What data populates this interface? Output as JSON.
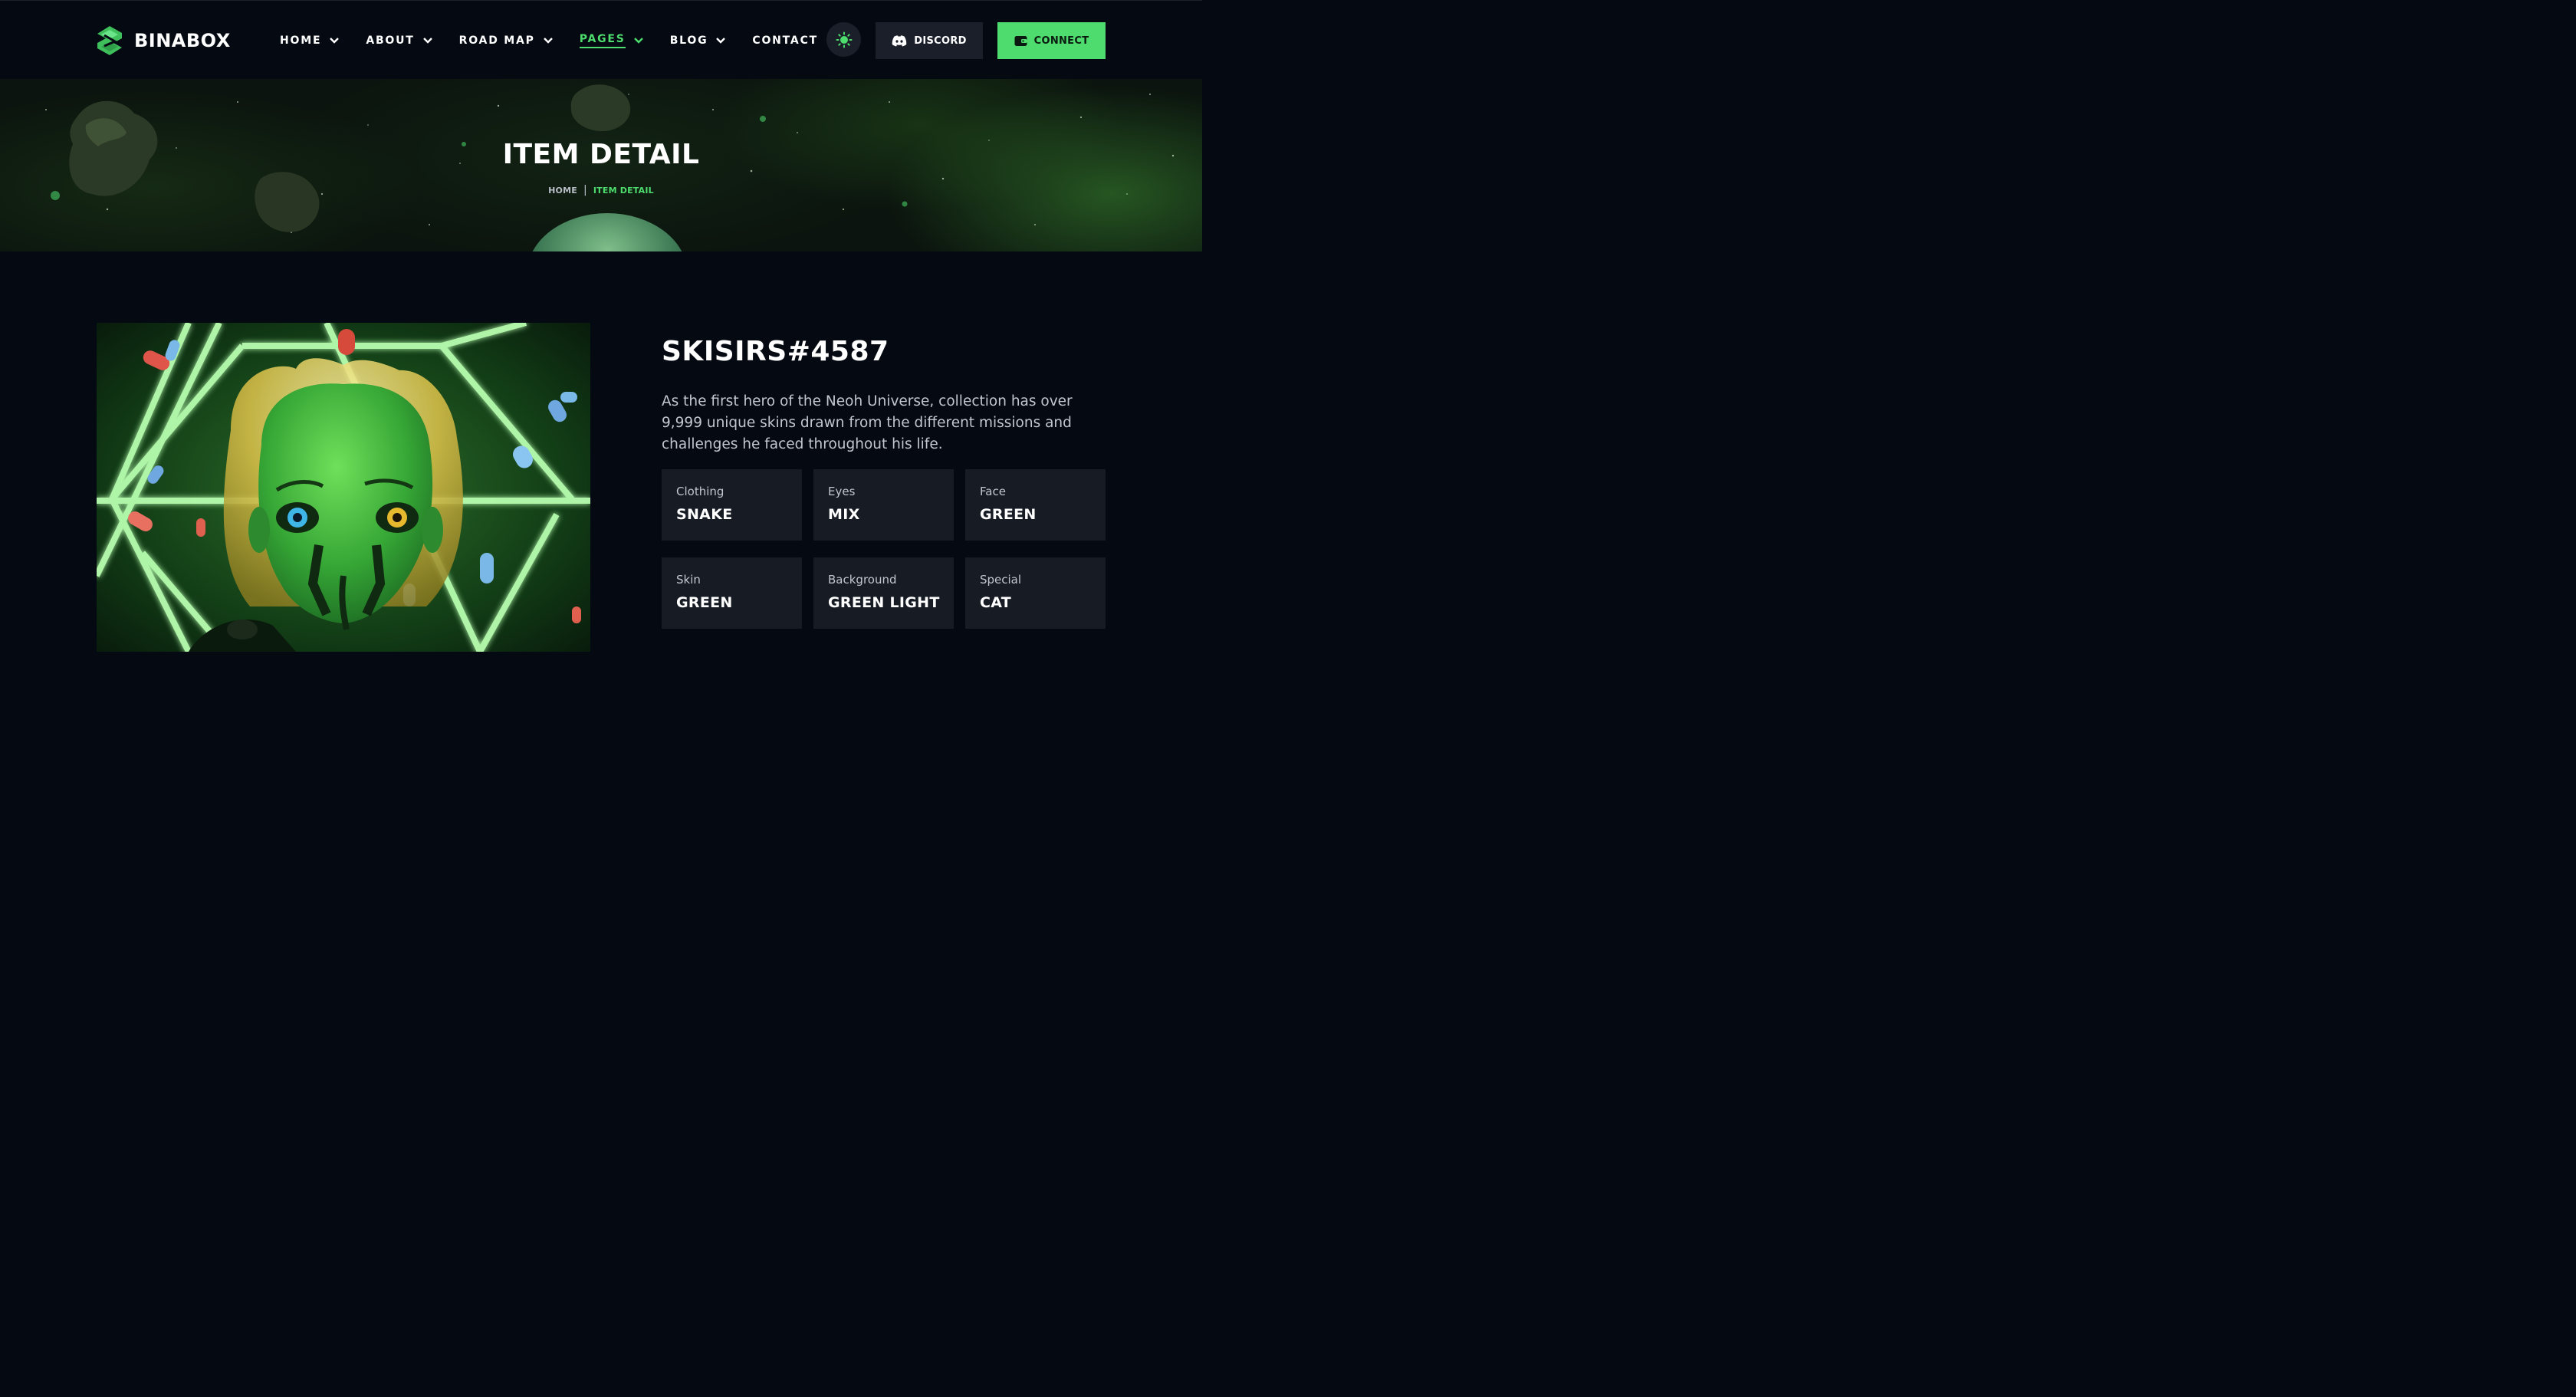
{
  "brand": {
    "name": "BINABOX",
    "accent": "#4ddc6d",
    "background": "#050a12"
  },
  "nav": [
    {
      "label": "HOME",
      "has_dropdown": true,
      "active": false
    },
    {
      "label": "ABOUT",
      "has_dropdown": true,
      "active": false
    },
    {
      "label": "ROAD MAP",
      "has_dropdown": true,
      "active": false
    },
    {
      "label": "PAGES",
      "has_dropdown": true,
      "active": true
    },
    {
      "label": "BLOG",
      "has_dropdown": true,
      "active": false
    },
    {
      "label": "CONTACT",
      "has_dropdown": false,
      "active": false
    }
  ],
  "header_actions": {
    "theme_icon": "sun-icon",
    "discord_label": "DISCORD",
    "discord_icon": "discord-icon",
    "connect_label": "CONNECT",
    "connect_icon": "wallet-icon"
  },
  "banner": {
    "title": "ITEM DETAIL",
    "breadcrumb": {
      "home": "HOME",
      "separator": "|",
      "current": "ITEM DETAIL"
    }
  },
  "item": {
    "name": "SKISIRS#4587",
    "description": "As the first hero of the Neoh Universe, collection has over 9,999 unique skins drawn from the different missions and challenges he faced throughout his life.",
    "traits": [
      {
        "label": "Clothing",
        "value": "SNAKE"
      },
      {
        "label": "Eyes",
        "value": "MIX"
      },
      {
        "label": "Face",
        "value": "GREEN"
      },
      {
        "label": "Skin",
        "value": "GREEN"
      },
      {
        "label": "Background",
        "value": "GREEN LIGHT"
      },
      {
        "label": "Special",
        "value": "CAT"
      }
    ]
  }
}
